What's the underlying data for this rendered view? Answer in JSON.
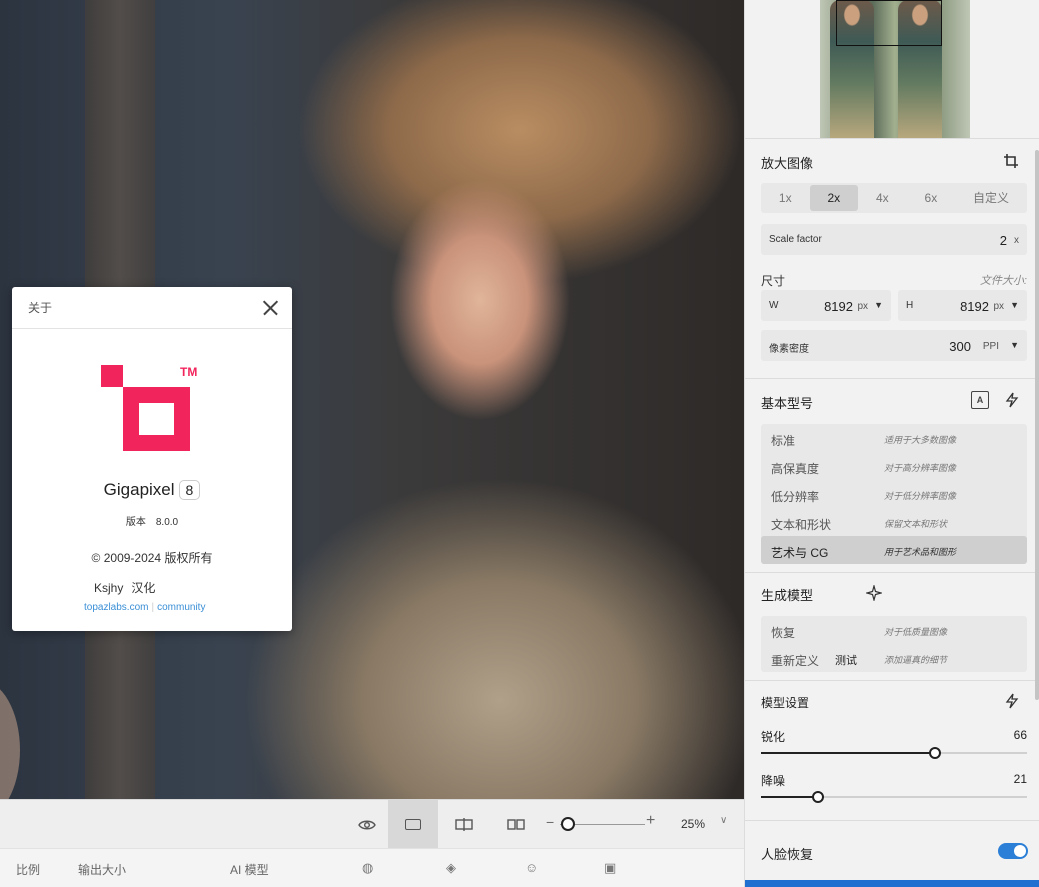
{
  "about": {
    "title": "关于",
    "app_name": "Gigapixel",
    "version_badge": "8",
    "version_label": "版本",
    "version_value": "8.0.0",
    "trademark": "TM",
    "copyright": "© 2009-2024 版权所有",
    "translator_name": "Ksjhy",
    "translator_note": "汉化",
    "link_site": "topazlabs.com",
    "link_community": "community"
  },
  "toolbar": {
    "zoom_value": "25%",
    "zoom_level": 0.1
  },
  "statusbar": {
    "ratio": "比例",
    "output_size": "输出大小",
    "ai_model": "AI 模型"
  },
  "panel": {
    "upscale": {
      "title": "放大图像",
      "options": [
        "1x",
        "2x",
        "4x",
        "6x",
        "自定义"
      ],
      "selected": "2x",
      "scale_factor_label": "Scale factor",
      "scale_factor_value": "2",
      "scale_factor_unit": "x"
    },
    "dimensions": {
      "label": "尺寸",
      "file_size_label": "文件大小:",
      "width_label": "W",
      "width_value": "8192",
      "width_unit": "px",
      "height_label": "H",
      "height_value": "8192",
      "height_unit": "px",
      "density_label": "像素密度",
      "density_value": "300",
      "density_unit": "PPI"
    },
    "base_models": {
      "title": "基本型号",
      "items": [
        {
          "name": "标准",
          "desc": "适用于大多数图像"
        },
        {
          "name": "高保真度",
          "desc": "对于高分辨率图像"
        },
        {
          "name": "低分辨率",
          "desc": "对于低分辨率图像"
        },
        {
          "name": "文本和形状",
          "desc": "保留文本和形状"
        },
        {
          "name": "艺术与 CG",
          "desc": "用于艺术品和图形"
        }
      ],
      "selected": "艺术与 CG"
    },
    "gen_models": {
      "title": "生成模型",
      "items": [
        {
          "name": "恢复",
          "tag": "",
          "desc": "对于低质量图像"
        },
        {
          "name": "重新定义",
          "tag": "测试",
          "desc": "添加逼真的细节"
        }
      ]
    },
    "model_settings": {
      "title": "模型设置",
      "sharpen_label": "锐化",
      "sharpen_value": "66",
      "denoise_label": "降噪",
      "denoise_value": "21"
    },
    "face_recovery": {
      "label": "人脸恢复",
      "enabled": true
    }
  },
  "colors": {
    "brand": "#f2245c",
    "accent": "#2c7fd6",
    "link": "#3a8fd6"
  }
}
